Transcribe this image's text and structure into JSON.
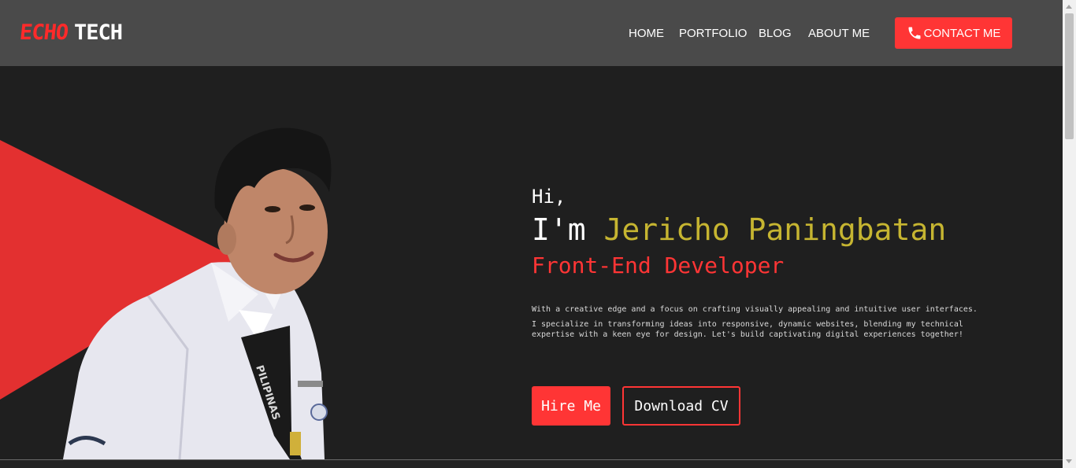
{
  "header": {
    "logo_primary": "ECHO",
    "logo_secondary": "TECH",
    "nav": {
      "home": "HOME",
      "portfolio": "PORTFOLIO",
      "blog": "BLOG",
      "about": "ABOUT ME"
    },
    "contact_label": "CONTACT ME",
    "contact_icon": "phone-icon"
  },
  "hero": {
    "greeting": "Hi,",
    "intro_prefix": "I'm ",
    "name": "Jericho Paningbatan",
    "role": "Front-End Developer",
    "description_line1": "With a creative edge and a focus on crafting visually appealing and intuitive user interfaces.",
    "description_line2": "I specialize in transforming ideas into responsive, dynamic websites, blending my technical expertise with a keen eye for design. Let's build captivating digital experiences together!",
    "hire_label": "Hire Me",
    "cv_label": "Download CV",
    "lanyard_text": "PILIPINAS"
  },
  "colors": {
    "accent": "#ff3535",
    "name_color": "#c6b531",
    "nav_background": "#4a4a4a",
    "page_background": "#1f1f1f"
  }
}
